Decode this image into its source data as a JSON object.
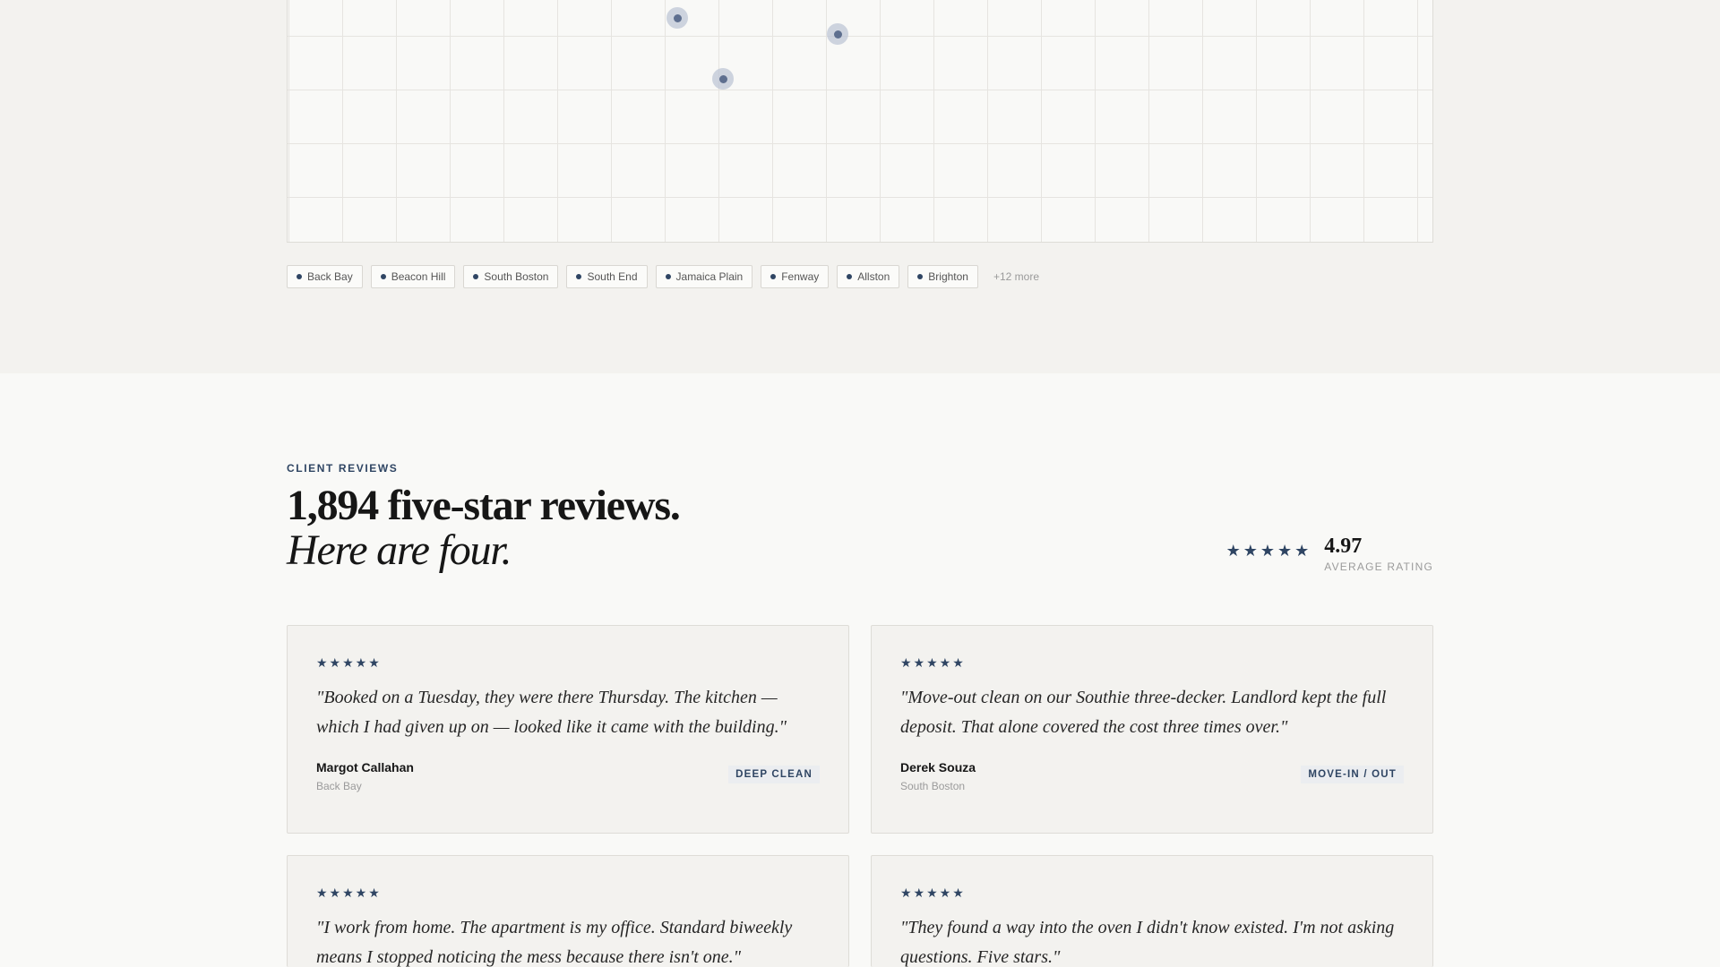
{
  "map": {
    "neighborhoods": [
      "Back Bay",
      "Beacon Hill",
      "South Boston",
      "South End",
      "Jamaica Plain",
      "Fenway",
      "Allston",
      "Brighton"
    ],
    "more_label": "+12 more"
  },
  "reviews": {
    "eyebrow": "CLIENT REVIEWS",
    "headline_line1": "1,894 five-star reviews.",
    "headline_line2": "Here are four.",
    "rating_stars": "★★★★★",
    "rating_value": "4.97",
    "rating_caption": "AVERAGE RATING",
    "items": [
      {
        "stars": "★★★★★",
        "quote": "\"Booked on a Tuesday, they were there Thursday. The kitchen — which I had given up on — looked like it came with the building.\"",
        "name": "Margot Callahan",
        "area": "Back Bay",
        "tag": "DEEP CLEAN"
      },
      {
        "stars": "★★★★★",
        "quote": "\"Move-out clean on our Southie three-decker. Landlord kept the full deposit. That alone covered the cost three times over.\"",
        "name": "Derek Souza",
        "area": "South Boston",
        "tag": "MOVE-IN / OUT"
      },
      {
        "stars": "★★★★★",
        "quote": "\"I work from home. The apartment is my office. Standard biweekly means I stopped noticing the mess because there isn't one.\""
      },
      {
        "stars": "★★★★★",
        "quote": "\"They found a way into the oven I didn't know existed. I'm not asking questions. Five stars.\""
      }
    ]
  },
  "colors": {
    "accent": "#2f4563",
    "section_bg": "#f3f2ef",
    "page_bg": "#f9f9f7"
  }
}
